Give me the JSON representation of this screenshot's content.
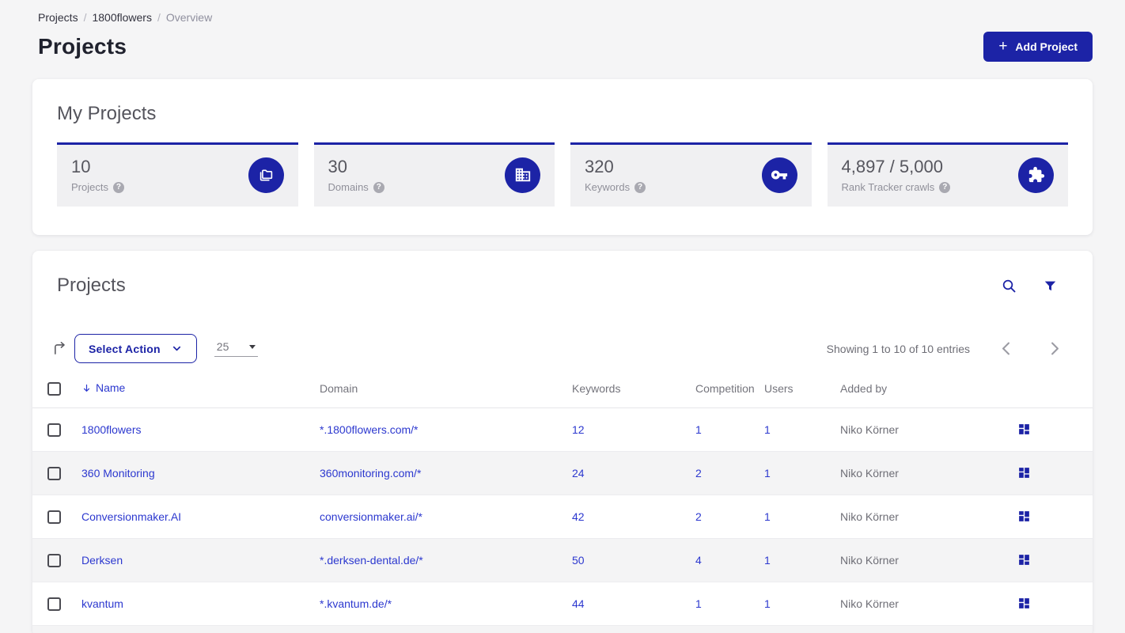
{
  "colors": {
    "brand": "#1c23a6",
    "link": "#2c38cf",
    "stripe": "#f4f4f5"
  },
  "breadcrumb": {
    "items": [
      {
        "label": "Projects"
      },
      {
        "label": "1800flowers"
      },
      {
        "label": "Overview"
      }
    ],
    "separator": "/"
  },
  "header": {
    "title": "Projects",
    "add_button": {
      "plus": "+",
      "label": "Add Project"
    }
  },
  "my_projects": {
    "title": "My Projects",
    "help_glyph": "?",
    "stats": [
      {
        "value": "10",
        "label": "Projects",
        "icon": "projects-folders-icon"
      },
      {
        "value": "30",
        "label": "Domains",
        "icon": "domains-building-icon"
      },
      {
        "value": "320",
        "label": "Keywords",
        "icon": "keywords-key-icon"
      },
      {
        "value": "4,897 / 5,000",
        "label": "Rank Tracker crawls",
        "icon": "rank-tracker-puzzle-icon"
      }
    ]
  },
  "projects_panel": {
    "title": "Projects",
    "icons": [
      "search-icon",
      "filter-icon"
    ],
    "toolbar": {
      "export_icon": "export-arrow-icon",
      "select_action_label": "Select Action",
      "page_size_value": "25",
      "showing_text": "Showing 1 to 10 of 10 entries",
      "pager_icons": [
        "chevron-left-icon",
        "chevron-right-icon"
      ]
    },
    "table": {
      "columns": {
        "name": "Name",
        "domain": "Domain",
        "keywords": "Keywords",
        "competition": "Competition",
        "users": "Users",
        "added_by": "Added by"
      },
      "rows": [
        {
          "name": "1800flowers",
          "domain": "*.1800flowers.com/*",
          "keywords": "12",
          "competition": "1",
          "users": "1",
          "added_by": "Niko Körner"
        },
        {
          "name": "360 Monitoring",
          "domain": "360monitoring.com/*",
          "keywords": "24",
          "competition": "2",
          "users": "1",
          "added_by": "Niko Körner"
        },
        {
          "name": "Conversionmaker.AI",
          "domain": "conversionmaker.ai/*",
          "keywords": "42",
          "competition": "2",
          "users": "1",
          "added_by": "Niko Körner"
        },
        {
          "name": "Derksen",
          "domain": "*.derksen-dental.de/*",
          "keywords": "50",
          "competition": "4",
          "users": "1",
          "added_by": "Niko Körner"
        },
        {
          "name": "kvantum",
          "domain": "*.kvantum.de/*",
          "keywords": "44",
          "competition": "1",
          "users": "1",
          "added_by": "Niko Körner"
        }
      ]
    }
  }
}
